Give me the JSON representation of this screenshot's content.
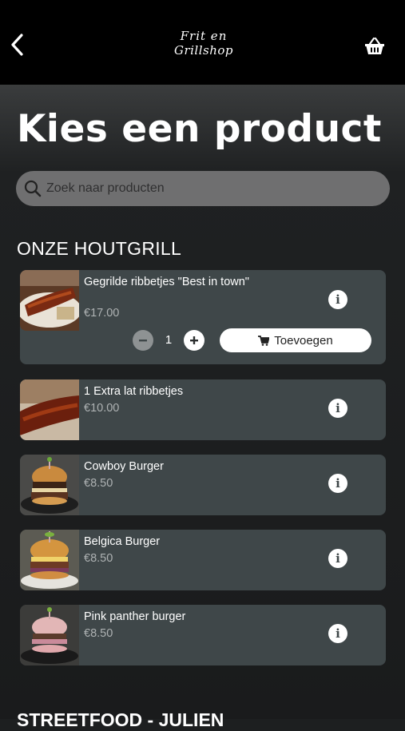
{
  "header": {
    "logo_line1": "Frit en",
    "logo_line2": "Grillshop",
    "back_icon": "chevron-left-icon",
    "basket_icon": "basket-icon"
  },
  "page": {
    "title": "Kies een product"
  },
  "search": {
    "placeholder": "Zoek naar producten",
    "value": ""
  },
  "section1": {
    "title": "ONZE HOUTGRILL",
    "products": [
      {
        "name": "Gegrilde ribbetjes \"Best in town\"",
        "price": "€17.00",
        "quantity": "1",
        "add_label": "Toevoegen"
      },
      {
        "name": "1 Extra lat ribbetjes",
        "price": "€10.00"
      },
      {
        "name": "Cowboy Burger",
        "price": "€8.50"
      },
      {
        "name": "Belgica Burger",
        "price": "€8.50"
      },
      {
        "name": "Pink panther burger",
        "price": "€8.50"
      }
    ]
  },
  "section2": {
    "title": "STREETFOOD - JULIEN"
  },
  "colors": {
    "card": "#3f4749",
    "search": "#6f6f70",
    "topbar": "#000000"
  }
}
